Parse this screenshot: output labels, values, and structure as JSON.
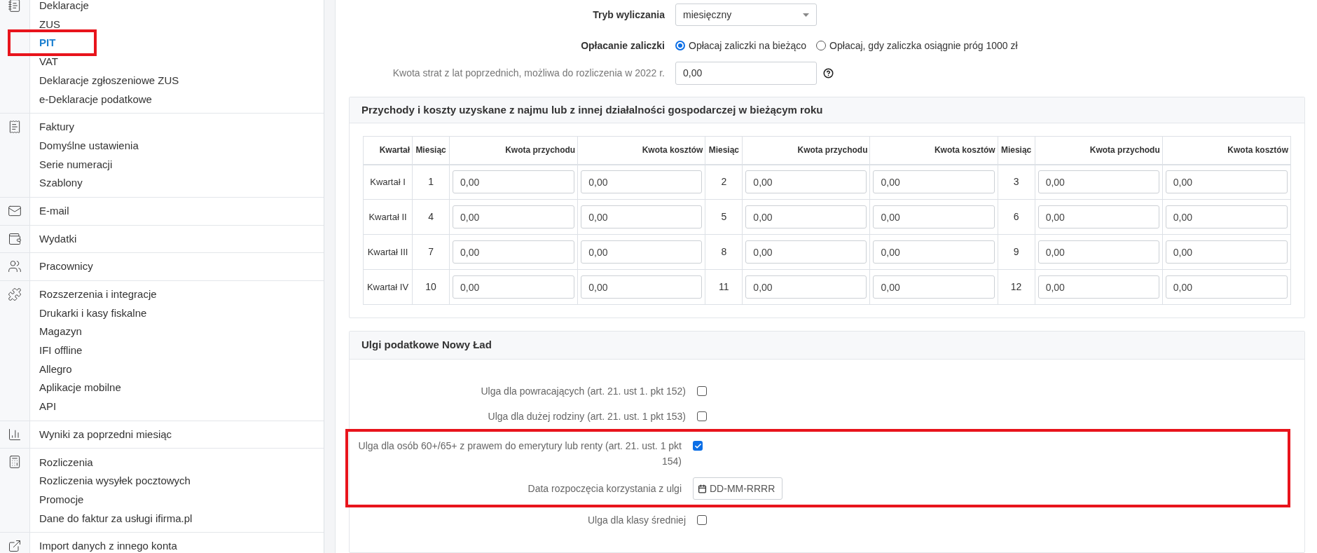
{
  "sidebar": {
    "groups": [
      {
        "items": [
          {
            "label": "Deklaracje",
            "selected": false,
            "highlighted": false
          },
          {
            "label": "ZUS",
            "selected": false,
            "highlighted": false
          },
          {
            "label": "PIT",
            "selected": true,
            "highlighted": true
          },
          {
            "label": "VAT",
            "selected": false,
            "highlighted": false
          },
          {
            "label": "Deklaracje zgłoszeniowe ZUS",
            "selected": false,
            "highlighted": false
          },
          {
            "label": "e-Deklaracje podatkowe",
            "selected": false,
            "highlighted": false
          }
        ]
      },
      {
        "items": [
          {
            "label": "Faktury",
            "selected": false,
            "highlighted": false
          },
          {
            "label": "Domyślne ustawienia",
            "selected": false,
            "highlighted": false
          },
          {
            "label": "Serie numeracji",
            "selected": false,
            "highlighted": false
          },
          {
            "label": "Szablony",
            "selected": false,
            "highlighted": false
          }
        ]
      },
      {
        "items": [
          {
            "label": "E-mail",
            "selected": false,
            "highlighted": false
          }
        ]
      },
      {
        "items": [
          {
            "label": "Wydatki",
            "selected": false,
            "highlighted": false
          }
        ]
      },
      {
        "items": [
          {
            "label": "Pracownicy",
            "selected": false,
            "highlighted": false
          }
        ]
      },
      {
        "items": [
          {
            "label": "Rozszerzenia i integracje",
            "selected": false,
            "highlighted": false
          },
          {
            "label": "Drukarki i kasy fiskalne",
            "selected": false,
            "highlighted": false
          },
          {
            "label": "Magazyn",
            "selected": false,
            "highlighted": false
          },
          {
            "label": "IFI offline",
            "selected": false,
            "highlighted": false
          },
          {
            "label": "Allegro",
            "selected": false,
            "highlighted": false
          },
          {
            "label": "Aplikacje mobilne",
            "selected": false,
            "highlighted": false
          },
          {
            "label": "API",
            "selected": false,
            "highlighted": false
          }
        ]
      },
      {
        "items": [
          {
            "label": "Wyniki za poprzedni miesiąc",
            "selected": false,
            "highlighted": false
          }
        ]
      },
      {
        "items": [
          {
            "label": "Rozliczenia",
            "selected": false,
            "highlighted": false
          },
          {
            "label": "Rozliczenia wysyłek pocztowych",
            "selected": false,
            "highlighted": false
          },
          {
            "label": "Promocje",
            "selected": false,
            "highlighted": false
          },
          {
            "label": "Dane do faktur za usługi ifirma.pl",
            "selected": false,
            "highlighted": false
          }
        ]
      },
      {
        "items": [
          {
            "label": "Import danych z innego konta",
            "selected": false,
            "highlighted": false
          }
        ]
      }
    ]
  },
  "form": {
    "mode": {
      "label": "Tryb wyliczania",
      "value": "miesięczny"
    },
    "advance": {
      "label": "Opłacanie zaliczki",
      "options": [
        {
          "label": "Opłacaj zaliczki na bieżąco",
          "selected": true
        },
        {
          "label": "Opłacaj, gdy zaliczka osiągnie próg 1000 zł",
          "selected": false
        }
      ]
    },
    "losses": {
      "label": "Kwota strat z lat poprzednich, możliwa do rozliczenia w 2022 r.",
      "value": "0,00"
    }
  },
  "revenue_panel": {
    "title": "Przychody i koszty uzyskane z najmu lub z innej działalności gospodarczej w bieżącym roku",
    "columns": [
      "Kwartał",
      "Miesiąc",
      "Kwota przychodu",
      "Kwota kosztów",
      "Miesiąc",
      "Kwota przychodu",
      "Kwota kosztów",
      "Miesiąc",
      "Kwota przychodu",
      "Kwota kosztów"
    ],
    "rows": [
      {
        "quarter": "Kwartał I",
        "months": [
          {
            "month": "1",
            "revenue": "0,00",
            "costs": "0,00"
          },
          {
            "month": "2",
            "revenue": "0,00",
            "costs": "0,00"
          },
          {
            "month": "3",
            "revenue": "0,00",
            "costs": "0,00"
          }
        ]
      },
      {
        "quarter": "Kwartał II",
        "months": [
          {
            "month": "4",
            "revenue": "0,00",
            "costs": "0,00"
          },
          {
            "month": "5",
            "revenue": "0,00",
            "costs": "0,00"
          },
          {
            "month": "6",
            "revenue": "0,00",
            "costs": "0,00"
          }
        ]
      },
      {
        "quarter": "Kwartał III",
        "months": [
          {
            "month": "7",
            "revenue": "0,00",
            "costs": "0,00"
          },
          {
            "month": "8",
            "revenue": "0,00",
            "costs": "0,00"
          },
          {
            "month": "9",
            "revenue": "0,00",
            "costs": "0,00"
          }
        ]
      },
      {
        "quarter": "Kwartał IV",
        "months": [
          {
            "month": "10",
            "revenue": "0,00",
            "costs": "0,00"
          },
          {
            "month": "11",
            "revenue": "0,00",
            "costs": "0,00"
          },
          {
            "month": "12",
            "revenue": "0,00",
            "costs": "0,00"
          }
        ]
      }
    ]
  },
  "reliefs_panel": {
    "title": "Ulgi podatkowe Nowy Ład",
    "items": [
      {
        "kind": "checkbox",
        "label": "Ulga dla powracających (art. 21. ust 1. pkt 152)",
        "checked": false,
        "highlighted": false
      },
      {
        "kind": "checkbox",
        "label": "Ulga dla dużej rodziny (art. 21. ust. 1 pkt 153)",
        "checked": false,
        "highlighted": false
      },
      {
        "kind": "checkbox",
        "label": "Ulga dla osób 60+/65+ z prawem do emerytury lub renty (art. 21. ust. 1 pkt 154)",
        "checked": true,
        "highlighted": true
      },
      {
        "kind": "date",
        "label": "Data rozpoczęcia korzystania z ulgi",
        "placeholder": "DD-MM-RRRR",
        "highlighted": true
      },
      {
        "kind": "checkbox",
        "label": "Ulga dla klasy średniej",
        "checked": false,
        "highlighted": false
      }
    ]
  }
}
